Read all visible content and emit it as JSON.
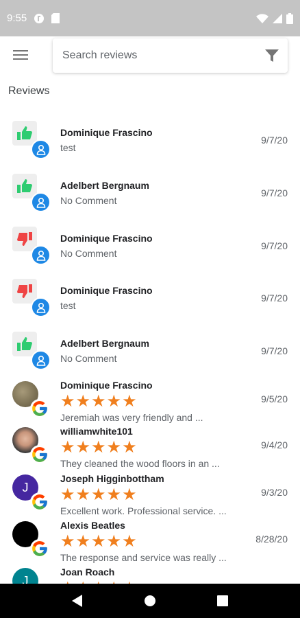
{
  "status_bar": {
    "time": "9:55"
  },
  "search": {
    "placeholder": "Search reviews"
  },
  "section_title": "Reviews",
  "colors": {
    "star": "#f07f1e",
    "thumb_up": "#2ecc71",
    "thumb_down": "#ef4444",
    "facebook_badge": "#1e88e5"
  },
  "reviews": [
    {
      "name": "Dominique Frascino",
      "text": "test",
      "date": "9/7/20",
      "source": "facebook",
      "sentiment": "thumb-up"
    },
    {
      "name": "Adelbert Bergnaum",
      "text": "No Comment",
      "date": "9/7/20",
      "source": "facebook",
      "sentiment": "thumb-up"
    },
    {
      "name": "Dominique Frascino",
      "text": "No Comment",
      "date": "9/7/20",
      "source": "facebook",
      "sentiment": "thumb-down"
    },
    {
      "name": "Dominique Frascino",
      "text": "test",
      "date": "9/7/20",
      "source": "facebook",
      "sentiment": "thumb-down"
    },
    {
      "name": "Adelbert Bergnaum",
      "text": "No Comment",
      "date": "9/7/20",
      "source": "facebook",
      "sentiment": "thumb-up"
    },
    {
      "name": "Dominique Frascino",
      "text": "Jeremiah was very friendly and ...",
      "date": "9/5/20",
      "source": "google",
      "rating": 5,
      "avatar": "photo-landscape"
    },
    {
      "name": "williamwhite101",
      "text": "They cleaned the wood floors in an ...",
      "date": "9/4/20",
      "source": "google",
      "rating": 5,
      "avatar": "photo-person"
    },
    {
      "name": "Joseph Higginbottham",
      "text": "Excellent work. Professional service. ...",
      "date": "9/3/20",
      "source": "google",
      "rating": 5,
      "avatar": "initial",
      "initial": "J",
      "avatar_color": "#4527a0"
    },
    {
      "name": "Alexis Beatles",
      "text": "The response and service was really ...",
      "date": "8/28/20",
      "source": "google",
      "rating": 5,
      "avatar": "black"
    },
    {
      "name": "Joan Roach",
      "text": "",
      "date": "",
      "source": "google",
      "rating": 5,
      "avatar": "initial",
      "initial": "J",
      "avatar_color": "#00838f"
    }
  ]
}
